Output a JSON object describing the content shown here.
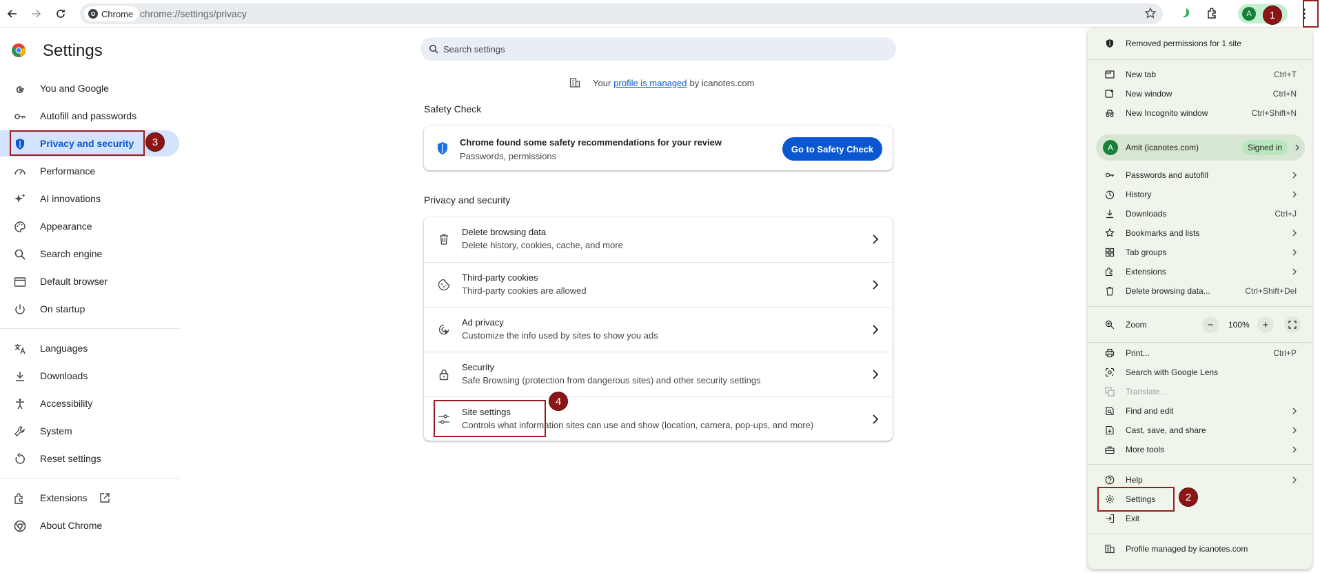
{
  "browser": {
    "chip_label": "Chrome",
    "url": "chrome://settings/privacy",
    "profile_initial": "A"
  },
  "sidebar": {
    "title": "Settings",
    "items": [
      {
        "label": "You and Google"
      },
      {
        "label": "Autofill and passwords"
      },
      {
        "label": "Privacy and security"
      },
      {
        "label": "Performance"
      },
      {
        "label": "AI innovations"
      },
      {
        "label": "Appearance"
      },
      {
        "label": "Search engine"
      },
      {
        "label": "Default browser"
      },
      {
        "label": "On startup"
      },
      {
        "label": "Languages"
      },
      {
        "label": "Downloads"
      },
      {
        "label": "Accessibility"
      },
      {
        "label": "System"
      },
      {
        "label": "Reset settings"
      },
      {
        "label": "Extensions"
      },
      {
        "label": "About Chrome"
      }
    ]
  },
  "search": {
    "placeholder": "Search settings"
  },
  "managed": {
    "prefix": "Your",
    "link": "profile is managed",
    "suffix": "by icanotes.com"
  },
  "safety": {
    "section_title": "Safety Check",
    "title": "Chrome found some safety recommendations for your review",
    "subtitle": "Passwords, permissions",
    "button": "Go to Safety Check"
  },
  "privacy": {
    "section_title": "Privacy and security",
    "rows": [
      {
        "title": "Delete browsing data",
        "desc": "Delete history, cookies, cache, and more"
      },
      {
        "title": "Third-party cookies",
        "desc": "Third-party cookies are allowed"
      },
      {
        "title": "Ad privacy",
        "desc": "Customize the info used by sites to show you ads"
      },
      {
        "title": "Security",
        "desc": "Safe Browsing (protection from dangerous sites) and other security settings"
      },
      {
        "title": "Site settings",
        "desc": "Controls what information sites can use and show (location, camera, pop-ups, and more)"
      }
    ]
  },
  "menu": {
    "removed_permissions": "Removed permissions for 1 site",
    "new_tab": {
      "label": "New tab",
      "shortcut": "Ctrl+T"
    },
    "new_window": {
      "label": "New window",
      "shortcut": "Ctrl+N"
    },
    "incognito": {
      "label": "New Incognito window",
      "shortcut": "Ctrl+Shift+N"
    },
    "profile": {
      "initial": "A",
      "name": "Amit (icanotes.com)",
      "status": "Signed in"
    },
    "passwords": "Passwords and autofill",
    "history": "History",
    "downloads": {
      "label": "Downloads",
      "shortcut": "Ctrl+J"
    },
    "bookmarks": "Bookmarks and lists",
    "tab_groups": "Tab groups",
    "extensions": "Extensions",
    "delete_data": {
      "label": "Delete browsing data...",
      "shortcut": "Ctrl+Shift+Del"
    },
    "zoom": {
      "label": "Zoom",
      "minus": "−",
      "value": "100%",
      "plus": "+"
    },
    "print": {
      "label": "Print...",
      "shortcut": "Ctrl+P"
    },
    "lens": "Search with Google Lens",
    "translate": "Translate...",
    "find_edit": "Find and edit",
    "cast": "Cast, save, and share",
    "more_tools": "More tools",
    "help": "Help",
    "settings": "Settings",
    "exit": "Exit",
    "managed": "Profile managed by icanotes.com"
  },
  "callouts": {
    "one": "1",
    "two": "2",
    "three": "3",
    "four": "4"
  },
  "colors": {
    "accent": "#0b57d0",
    "callout": "#8b1414",
    "menu_bg": "#f0f5ec"
  }
}
